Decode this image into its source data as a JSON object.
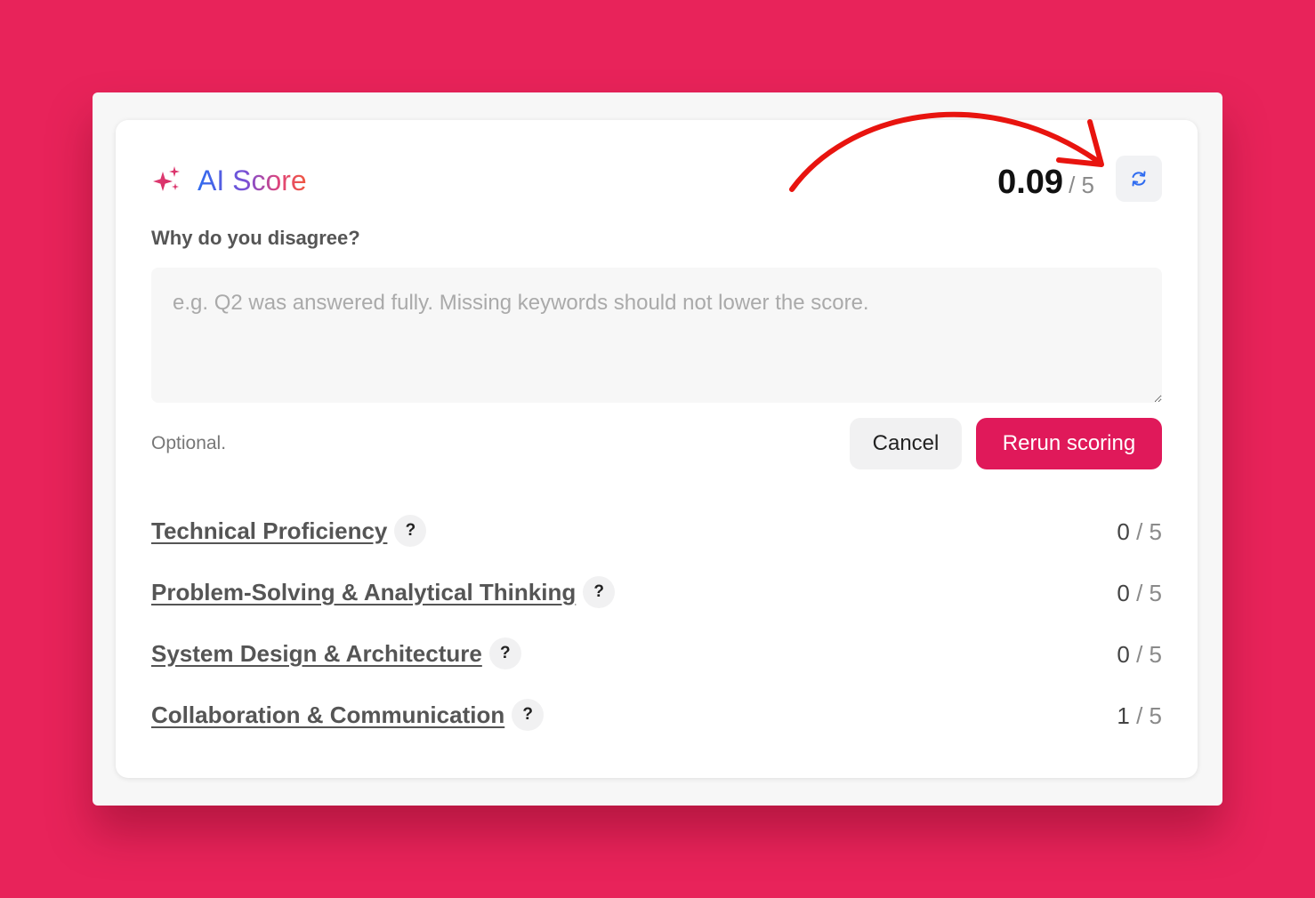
{
  "header": {
    "title": "AI Score",
    "score": "0.09",
    "score_max": "/ 5",
    "sparkle_icon": "sparkle-icon",
    "refresh_icon": "refresh-icon"
  },
  "feedback": {
    "question": "Why do you disagree?",
    "placeholder": "e.g. Q2 was answered fully. Missing keywords should not lower the score.",
    "value": "",
    "hint": "Optional."
  },
  "actions": {
    "cancel_label": "Cancel",
    "rerun_label": "Rerun scoring"
  },
  "criteria": [
    {
      "name": "Technical Proficiency",
      "score": "0",
      "max": "/ 5"
    },
    {
      "name": "Problem-Solving & Analytical Thinking",
      "score": "0",
      "max": "/ 5"
    },
    {
      "name": "System Design & Architecture",
      "score": "0",
      "max": "/ 5"
    },
    {
      "name": "Collaboration & Communication",
      "score": "1",
      "max": "/ 5"
    }
  ],
  "help_label": "?",
  "colors": {
    "background": "#e8235a",
    "accent": "#e0195a",
    "annotation_arrow": "#e8140f"
  }
}
